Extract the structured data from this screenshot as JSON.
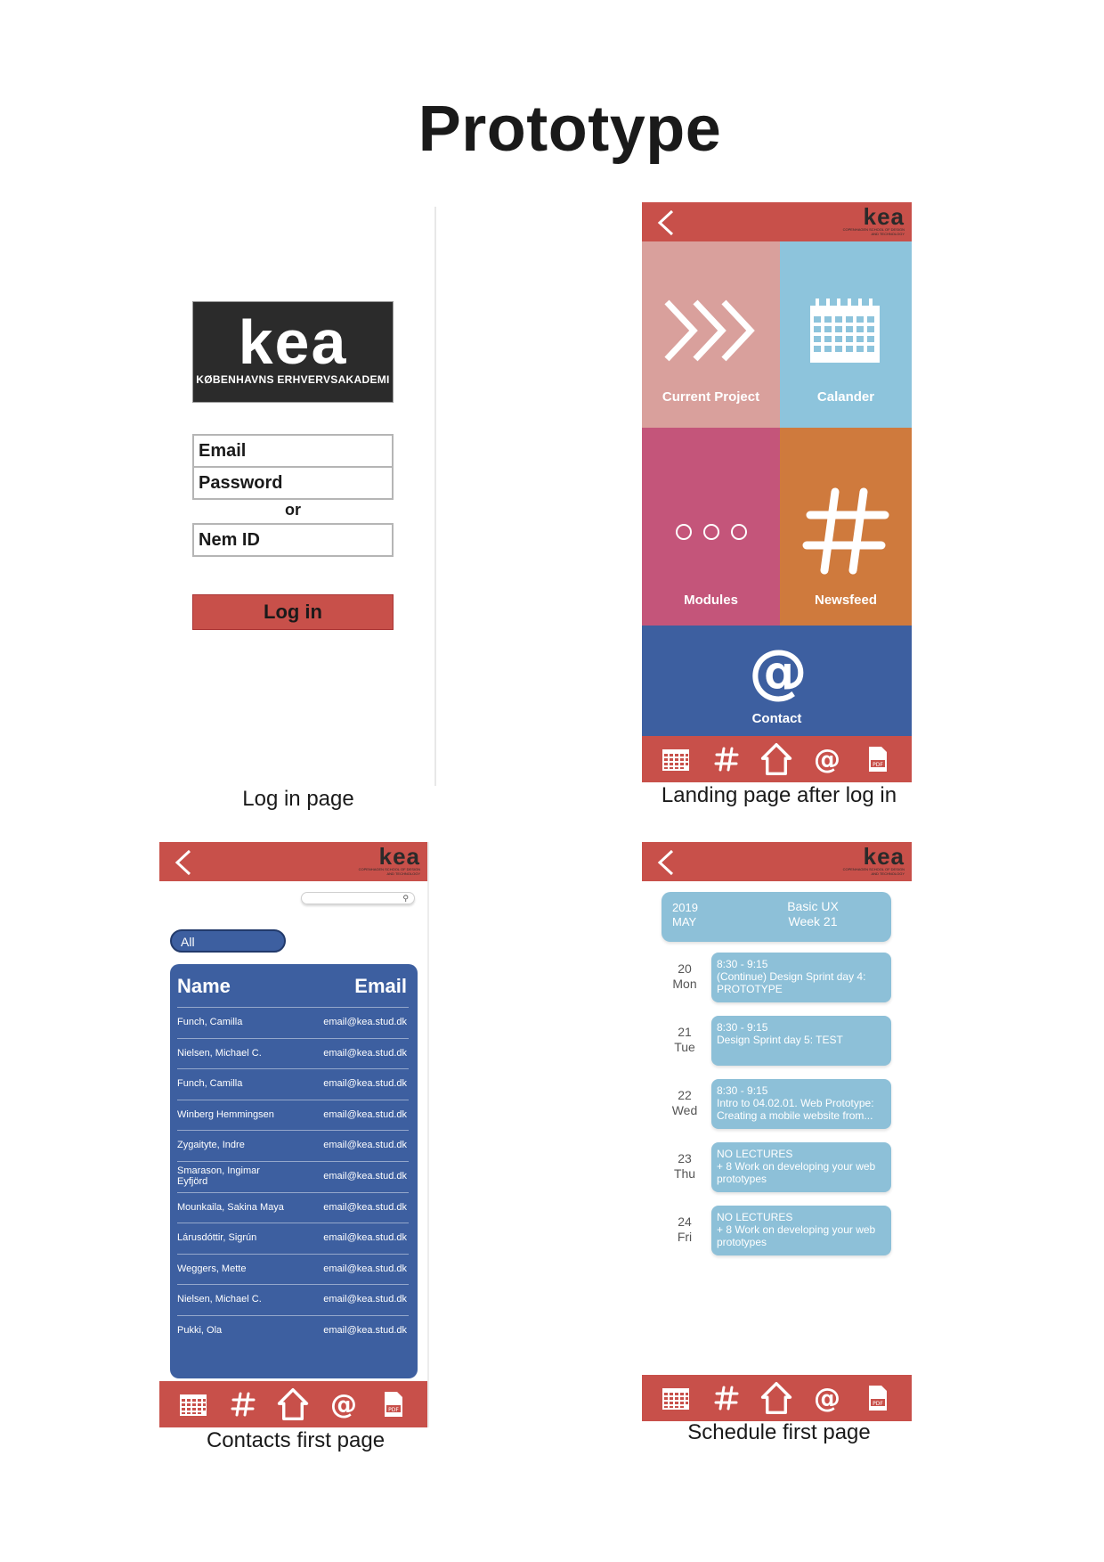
{
  "document": {
    "title": "Prototype"
  },
  "login": {
    "logo_word": "kea",
    "logo_sub": "KØBENHAVNS ERHVERVSAKADEMI",
    "email_label": "Email",
    "password_label": "Password",
    "or_text": "or",
    "nemid_label": "Nem ID",
    "login_button": "Log in",
    "caption": "Log in page"
  },
  "header": {
    "logo_word": "kea",
    "logo_sub": "COPENHAGEN SCHOOL OF DESIGN AND TECHNOLOGY"
  },
  "landing": {
    "tiles": [
      {
        "label": "Current Project",
        "color": "#d9a09c",
        "icon": "chevrons-icon"
      },
      {
        "label": "Calander",
        "color": "#8dc4dc",
        "icon": "calendar-icon"
      },
      {
        "label": "Modules",
        "color": "#c4557a",
        "icon": "three-circles-icon"
      },
      {
        "label": "Newsfeed",
        "color": "#cf7a3d",
        "icon": "hashtag-icon"
      },
      {
        "label": "Contact",
        "color": "#3d5fa0",
        "icon": "at-icon"
      }
    ],
    "caption": "Landing page after log in"
  },
  "bottom_nav": [
    "calendar-icon",
    "hashtag-icon",
    "home-icon",
    "at-icon",
    "pdf-icon"
  ],
  "contacts": {
    "filter": "All",
    "columns": {
      "name": "Name",
      "email": "Email"
    },
    "rows": [
      {
        "name": "Funch, Camilla",
        "email": "email@kea.stud.dk"
      },
      {
        "name": "Nielsen, Michael C.",
        "email": "email@kea.stud.dk"
      },
      {
        "name": "Funch, Camilla",
        "email": "email@kea.stud.dk"
      },
      {
        "name": "Winberg Hemmingsen",
        "email": "email@kea.stud.dk"
      },
      {
        "name": "Zygaityte, Indre",
        "email": "email@kea.stud.dk"
      },
      {
        "name": "Smarason, Ingimar Eyfjörd",
        "email": "email@kea.stud.dk"
      },
      {
        "name": "Mounkaila, Sakina Maya",
        "email": "email@kea.stud.dk"
      },
      {
        "name": "Lárusdóttir, Sigrún",
        "email": "email@kea.stud.dk"
      },
      {
        "name": "Weggers, Mette",
        "email": "email@kea.stud.dk"
      },
      {
        "name": "Nielsen, Michael C.",
        "email": "email@kea.stud.dk"
      },
      {
        "name": "Pukki, Ola",
        "email": "email@kea.stud.dk"
      }
    ],
    "caption": "Contacts first page"
  },
  "schedule": {
    "year": "2019",
    "month": "MAY",
    "course": "Basic UX",
    "week": "Week 21",
    "days": [
      {
        "date": "20",
        "weekday": "Mon",
        "time": "8:30 - 9:15",
        "desc": "(Continue) Design Sprint day 4: PROTOTYPE"
      },
      {
        "date": "21",
        "weekday": "Tue",
        "time": "8:30 - 9:15",
        "desc": "Design Sprint day 5: TEST"
      },
      {
        "date": "22",
        "weekday": "Wed",
        "time": "8:30 - 9:15",
        "desc": "Intro to 04.02.01. Web Prototype: Creating a mobile website from..."
      },
      {
        "date": "23",
        "weekday": "Thu",
        "time": "NO LECTURES",
        "desc": "+ 8 Work on developing your web prototypes"
      },
      {
        "date": "24",
        "weekday": "Fri",
        "time": "NO LECTURES",
        "desc": "+ 8 Work on developing your web prototypes"
      }
    ],
    "caption": "Schedule first page"
  }
}
